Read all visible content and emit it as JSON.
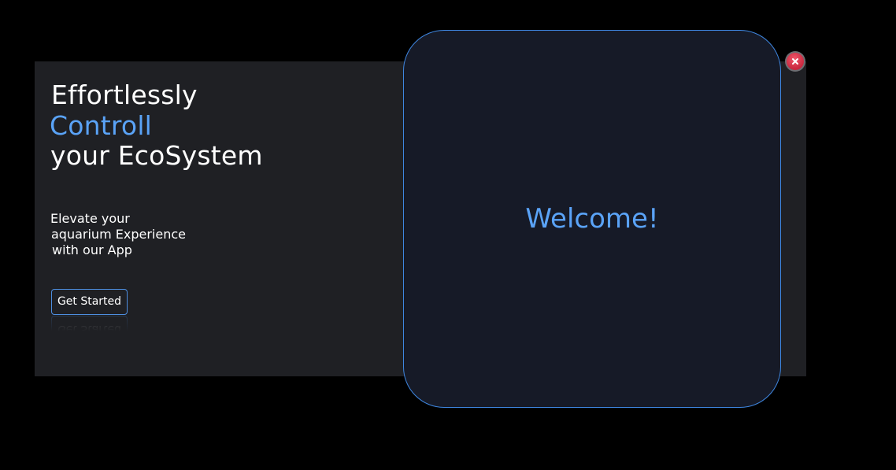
{
  "hero": {
    "headline": {
      "line1": "Effortlessly",
      "line2": "Controll",
      "line3": "your EcoSystem"
    },
    "tagline": {
      "line1": "Elevate your",
      "line2": "aquarium Experience",
      "line3": "with our App"
    },
    "cta_label": "Get Started"
  },
  "welcome_panel": {
    "message": "Welcome!"
  },
  "close_button": {
    "icon": "close-icon"
  },
  "colors": {
    "accent": "#5aa3f7",
    "panel_border": "#3e86e0",
    "window_bg": "#1f2024",
    "panel_bg": "#161a27",
    "close_red": "#e04256"
  }
}
